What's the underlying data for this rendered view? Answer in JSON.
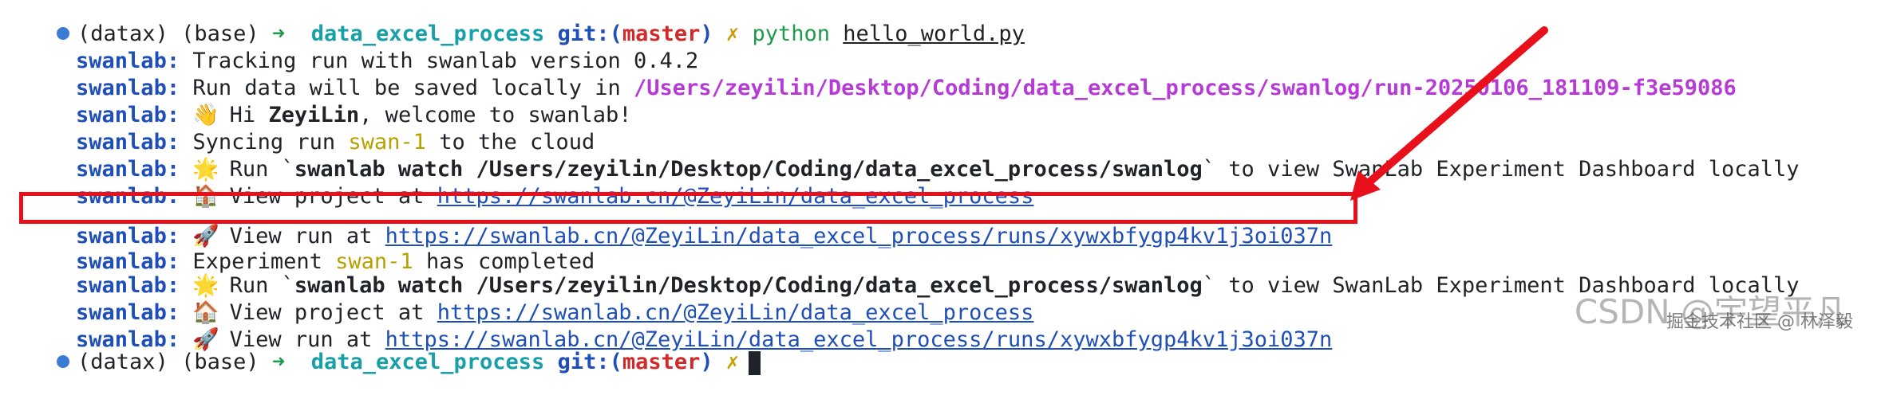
{
  "terminal": {
    "prompt1": {
      "env": "(datax)",
      "base": "(base)",
      "arrow": "➜",
      "dir": "data_excel_process",
      "git_prefix": "git:(",
      "branch": "master",
      "git_suffix": ")",
      "xmark": "✗",
      "cmd": "python",
      "arg": "hello_world.py"
    },
    "lines": [
      {
        "prefix": "swanlab:",
        "text": " Tracking run with swanlab version 0.4.2"
      },
      {
        "prefix": "swanlab:",
        "text": " Run data will be saved locally in ",
        "path": "/Users/zeyilin/Desktop/Coding/data_excel_process/swanlog/run-20250106_181109-f3e59086"
      },
      {
        "prefix": "swanlab:",
        "emoji": "👋",
        "text1": " Hi ",
        "bold": "ZeyiLin",
        "text2": ", welcome to swanlab!"
      },
      {
        "prefix": "swanlab:",
        "text1": " Syncing run ",
        "run": "swan-1",
        "text2": " to the cloud"
      },
      {
        "prefix": "swanlab:",
        "emoji": "🌟",
        "text1": " Run `",
        "bold": "swanlab watch /Users/zeyilin/Desktop/Coding/data_excel_process/swanlog",
        "text2": "` to view SwanLab Experiment Dashboard locally"
      },
      {
        "prefix": "swanlab:",
        "emoji": "🏠",
        "text1": " View project at ",
        "link": "https://swanlab.cn/@ZeyiLin/data_excel_process"
      },
      {
        "prefix": "swanlab:",
        "emoji": "🚀",
        "text1": " View run at ",
        "link": "https://swanlab.cn/@ZeyiLin/data_excel_process/runs/xywxbfygp4kv1j3oi037n"
      },
      {
        "prefix": "swanlab:",
        "text1": " Experiment ",
        "run": "swan-1",
        "text2": " has completed"
      },
      {
        "prefix": "swanlab:",
        "emoji": "🌟",
        "text1": " Run `",
        "bold": "swanlab watch /Users/zeyilin/Desktop/Coding/data_excel_process/swanlog",
        "text2": "` to view SwanLab Experiment Dashboard locally"
      },
      {
        "prefix": "swanlab:",
        "emoji": "🏠",
        "text1": " View project at ",
        "link": "https://swanlab.cn/@ZeyiLin/data_excel_process"
      },
      {
        "prefix": "swanlab:",
        "emoji": "🚀",
        "text1": " View run at ",
        "link": "https://swanlab.cn/@ZeyiLin/data_excel_process/runs/xywxbfygp4kv1j3oi037n"
      }
    ],
    "prompt2": {
      "env": "(datax)",
      "base": "(base)",
      "arrow": "➜",
      "dir": "data_excel_process",
      "git_prefix": "git:(",
      "branch": "master",
      "git_suffix": ")",
      "xmark": "✗"
    }
  },
  "watermark": {
    "main": "CSDN @宇望平凡",
    "sub": "掘金技术社区 @ 林泽毅"
  },
  "colors": {
    "highlight": "#e8101a",
    "prefix": "#1e4fb8",
    "path": "#b63ad6",
    "link": "#1e4fb8"
  }
}
